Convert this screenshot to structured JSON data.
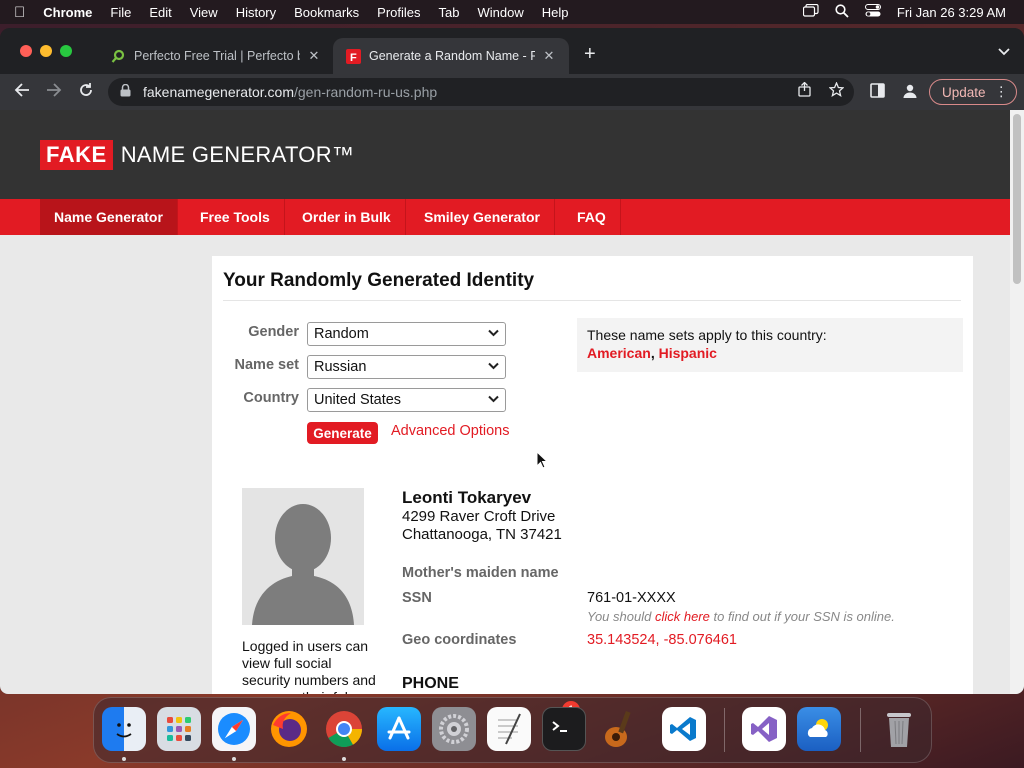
{
  "menubar": {
    "app_name": "Chrome",
    "items": [
      "File",
      "Edit",
      "View",
      "History",
      "Bookmarks",
      "Profiles",
      "Tab",
      "Window",
      "Help"
    ],
    "clock": "Fri Jan 26  3:29 AM"
  },
  "browser": {
    "tabs": [
      {
        "title": "Perfecto Free Trial | Perfecto by",
        "favicon": "perfecto-icon"
      },
      {
        "title": "Generate a Random Name - Ra",
        "favicon": "fakename-icon"
      }
    ],
    "url_domain": "fakenamegenerator.com",
    "url_path": "/gen-random-ru-us.php",
    "update_label": "Update"
  },
  "site": {
    "logo_fake": "FAKE",
    "logo_rest": "NAME GENERATOR™",
    "nav": [
      "Name Generator",
      "Free Tools",
      "Order in Bulk",
      "Smiley Generator",
      "FAQ"
    ],
    "accent": "#e21b23"
  },
  "content": {
    "title": "Your Randomly Generated Identity",
    "form": {
      "gender_label": "Gender",
      "gender_value": "Random",
      "nameset_label": "Name set",
      "nameset_value": "Russian",
      "country_label": "Country",
      "country_value": "United States",
      "generate_label": "Generate",
      "advanced_label": "Advanced Options"
    },
    "nameset_box": {
      "text": "These name sets apply to this country:",
      "link1": "American",
      "separator": ", ",
      "link2": "Hispanic"
    },
    "avatar_note": "Logged in users can view full social security numbers and can save their fake",
    "person": {
      "name": "Leonti Tokaryev",
      "address_line1": "4299 Raver Croft Drive",
      "address_line2": "Chattanooga, TN 37421",
      "maiden_label": "Mother's maiden name",
      "ssn_label": "SSN",
      "ssn_value": "761-01-XXXX",
      "ssn_note_pre": "You should ",
      "ssn_note_link": "click here",
      "ssn_note_post": " to find out if your SSN is online.",
      "geo_label": "Geo coordinates",
      "geo_value": "35.143524, -85.076461",
      "phone_heading": "PHONE"
    }
  },
  "dock": {
    "apps": [
      "finder-icon",
      "launchpad-icon",
      "safari-icon",
      "firefox-icon",
      "chrome-icon",
      "app-store-icon",
      "system-settings-icon",
      "textedit-icon",
      "terminal-icon",
      "garageband-icon",
      "vscode-icon",
      "visual-studio-icon",
      "weather-icon",
      "trash-icon"
    ],
    "settings_badge": "1"
  }
}
